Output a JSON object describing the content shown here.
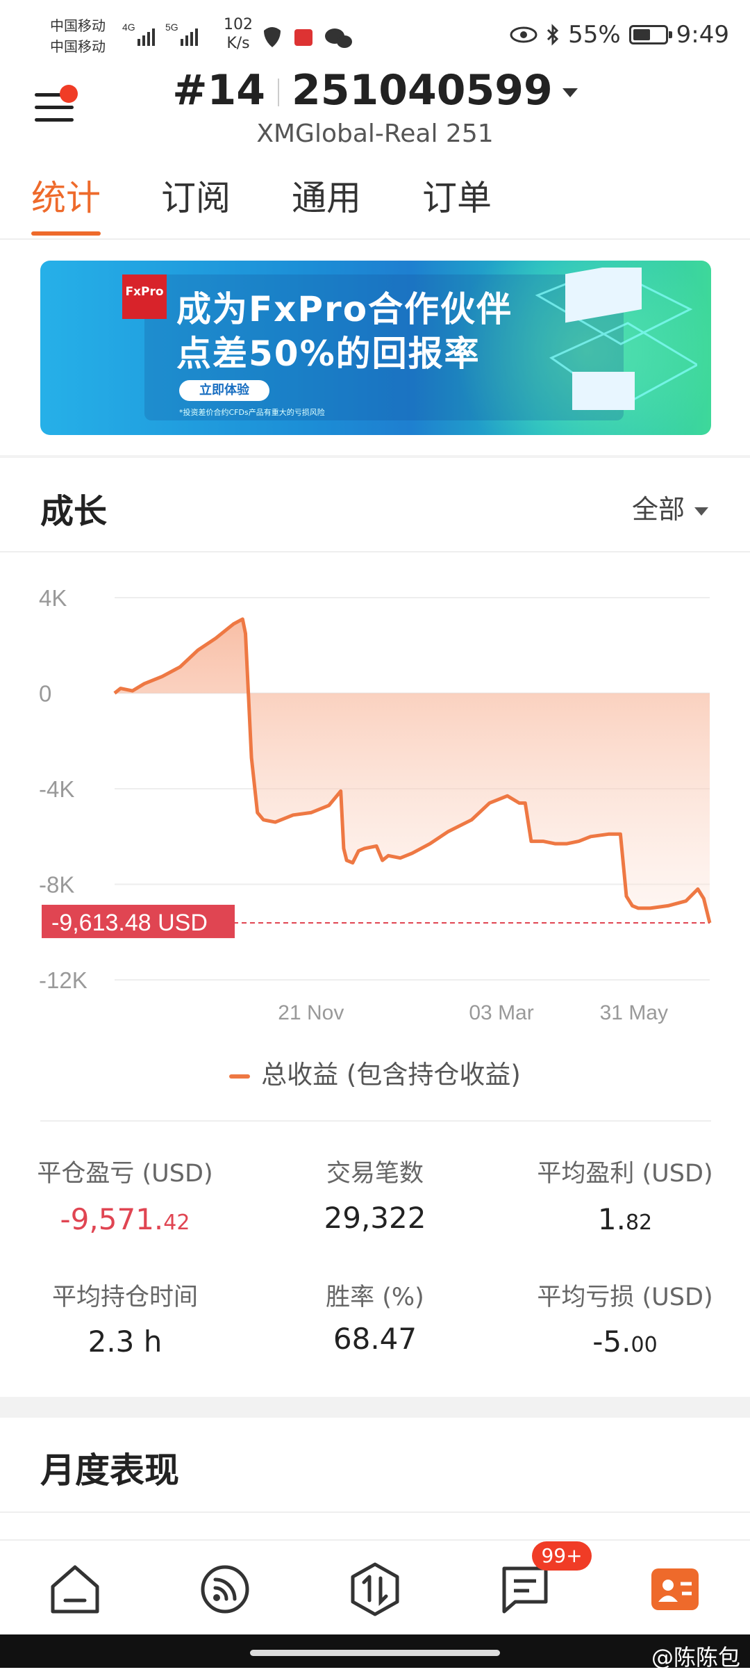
{
  "status_bar": {
    "carrier_1": "中国移动",
    "carrier_2": "中国移动",
    "speed_value": "102",
    "speed_unit": "K/s",
    "battery": "55%",
    "battery_level": 0.55,
    "time": "9:49"
  },
  "header": {
    "rank": "#14",
    "account_number": "251040599",
    "server": "XMGlobal-Real 251"
  },
  "tabs": [
    {
      "label": "统计",
      "active": true
    },
    {
      "label": "订阅",
      "active": false
    },
    {
      "label": "通用",
      "active": false
    },
    {
      "label": "订单",
      "active": false
    }
  ],
  "banner": {
    "logo": "FxPro",
    "line1": "成为FxPro合作伙伴",
    "line2": "点差50%的回报率",
    "button": "立即体验",
    "note": "*投资差价合约CFDs产品有重大的亏损风险"
  },
  "growth": {
    "title": "成长",
    "filter": "全部",
    "legend": "总收益 (包含持仓收益)",
    "current_label": "-9,613.48 USD"
  },
  "chart_data": {
    "type": "area",
    "title": "成长",
    "ylim": [
      -12000,
      4000
    ],
    "y_ticks": [
      "4K",
      "0",
      "-4K",
      "-8K",
      "-12K"
    ],
    "y_tick_values": [
      4000,
      0,
      -4000,
      -8000,
      -12000
    ],
    "x_ticks": [
      "21 Nov",
      "03 Mar",
      "31 May"
    ],
    "x_tick_positions": [
      0.33,
      0.65,
      0.93
    ],
    "current_value": -9613.48,
    "series": [
      {
        "name": "总收益 (包含持仓收益)",
        "color": "#ee7843",
        "x": [
          0,
          0.01,
          0.03,
          0.05,
          0.08,
          0.11,
          0.14,
          0.17,
          0.19,
          0.2,
          0.215,
          0.22,
          0.23,
          0.24,
          0.25,
          0.27,
          0.3,
          0.33,
          0.36,
          0.38,
          0.385,
          0.39,
          0.4,
          0.41,
          0.42,
          0.44,
          0.45,
          0.46,
          0.48,
          0.5,
          0.53,
          0.56,
          0.6,
          0.63,
          0.66,
          0.68,
          0.69,
          0.7,
          0.72,
          0.74,
          0.76,
          0.78,
          0.8,
          0.83,
          0.85,
          0.86,
          0.87,
          0.88,
          0.9,
          0.93,
          0.96,
          0.98,
          0.99,
          1.0
        ],
        "y": [
          0,
          200,
          100,
          400,
          700,
          1100,
          1800,
          2300,
          2700,
          2900,
          3100,
          2500,
          -2700,
          -5000,
          -5300,
          -5400,
          -5100,
          -5000,
          -4700,
          -4100,
          -6500,
          -7000,
          -7100,
          -6600,
          -6500,
          -6400,
          -7000,
          -6800,
          -6900,
          -6700,
          -6300,
          -5800,
          -5300,
          -4600,
          -4300,
          -4600,
          -4600,
          -6200,
          -6200,
          -6300,
          -6300,
          -6200,
          -6000,
          -5900,
          -5900,
          -8500,
          -8900,
          -9000,
          -9000,
          -8900,
          -8700,
          -8200,
          -8600,
          -9613.48
        ]
      }
    ]
  },
  "stats": [
    {
      "label": "平仓盈亏 (USD)",
      "int": "-9,571.",
      "dec": "42",
      "negative": true
    },
    {
      "label": "交易笔数",
      "int": "29,322",
      "dec": "",
      "negative": false
    },
    {
      "label": "平均盈利 (USD)",
      "int": "1.",
      "dec": "82",
      "negative": false
    },
    {
      "label": "平均持仓时间",
      "int": "2.3 h",
      "dec": "",
      "negative": false
    },
    {
      "label": "胜率 (%)",
      "int": "68.47",
      "dec": "",
      "negative": false
    },
    {
      "label": "平均亏损 (USD)",
      "int": "-5.",
      "dec": "00",
      "negative": false
    }
  ],
  "monthly": {
    "title": "月度表现"
  },
  "nav": {
    "badge": "99+",
    "items": [
      "home-icon",
      "feed-icon",
      "trade-icon",
      "message-icon",
      "profile-icon"
    ]
  },
  "watermark": "@陈陈包"
}
